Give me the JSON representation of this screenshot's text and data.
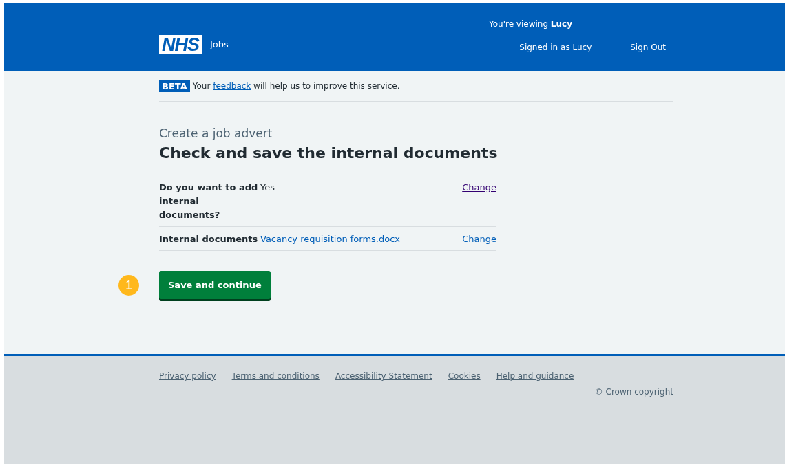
{
  "header": {
    "viewing_prefix": "You're viewing",
    "viewing_name": "Lucy",
    "logo": "NHS",
    "service": "Jobs",
    "signed_in": "Signed in as Lucy",
    "sign_out": "Sign Out"
  },
  "beta": {
    "tag": "BETA",
    "before": "Your",
    "link": "feedback",
    "after": "will help us to improve this service."
  },
  "caption": "Create a job advert",
  "heading": "Check and save the internal documents",
  "summary": [
    {
      "key": "Do you want to add internal documents?",
      "kind": "text",
      "value": "Yes",
      "action": "Change",
      "visited": true
    },
    {
      "key": "Internal documents",
      "kind": "link",
      "value": "Vacancy requisition forms.docx",
      "action": "Change",
      "visited": false
    }
  ],
  "step_marker": "1",
  "button": "Save and continue",
  "footer": {
    "links": [
      "Privacy policy",
      "Terms and conditions",
      "Accessibility Statement",
      "Cookies",
      "Help and guidance"
    ],
    "copyright": "© Crown copyright"
  }
}
